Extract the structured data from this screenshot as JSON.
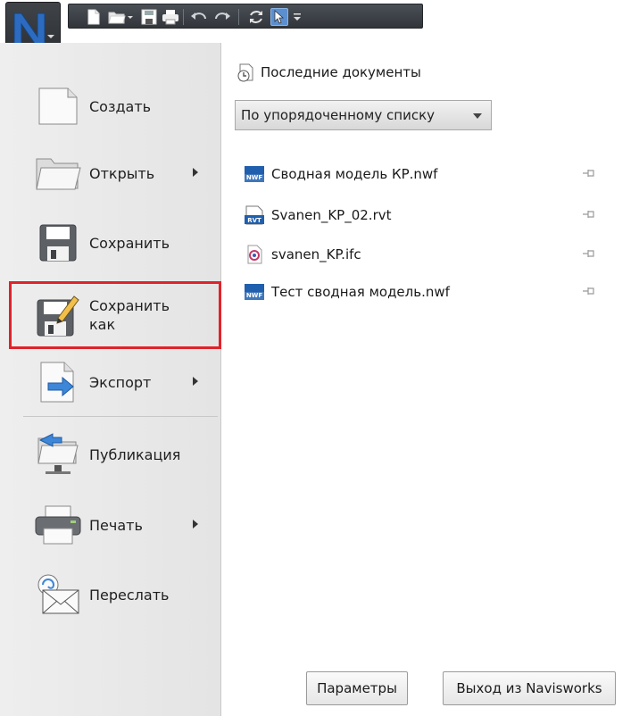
{
  "menu": {
    "items": [
      {
        "label": "Создать",
        "has_arrow": false
      },
      {
        "label": "Открыть",
        "has_arrow": true
      },
      {
        "label": "Сохранить",
        "has_arrow": false
      },
      {
        "label": "Сохранить как",
        "has_arrow": false,
        "highlighted": true
      },
      {
        "label": "Экспорт",
        "has_arrow": true
      },
      {
        "label": "Публикация",
        "has_arrow": false
      },
      {
        "label": "Печать",
        "has_arrow": true
      },
      {
        "label": "Переслать",
        "has_arrow": false
      }
    ],
    "highlight_color": "#e0222a"
  },
  "recent": {
    "title": "Последние документы",
    "sort_option": "По упорядоченному списку",
    "files": [
      {
        "name": "Сводная модель КР.nwf",
        "type_badge": "NWF"
      },
      {
        "name": "Svanen_KP_02.rvt",
        "type_badge": "RVT"
      },
      {
        "name": "svanen_KP.ifc",
        "type_badge": ""
      },
      {
        "name": "Тест сводная модель.nwf",
        "type_badge": "NWF"
      }
    ]
  },
  "footer": {
    "options_label": "Параметры",
    "exit_label": "Выход из Navisworks"
  },
  "app": {
    "logo_letter": "N",
    "accent": "#2c6bc0"
  }
}
